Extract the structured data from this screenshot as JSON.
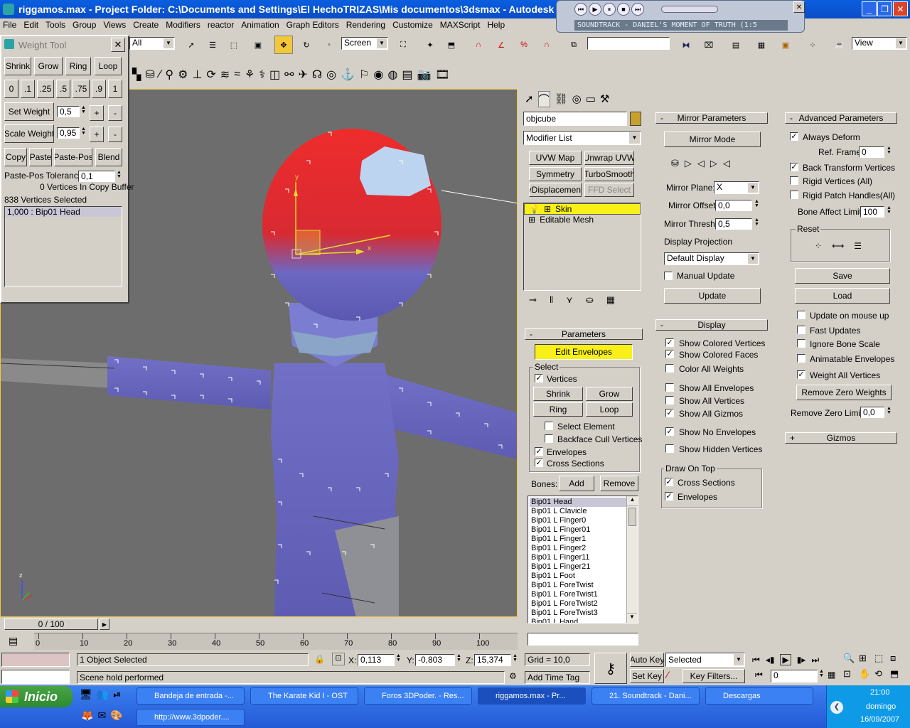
{
  "title_bar": {
    "title": "riggamos.max - Project Folder: C:\\Documents and Settings\\El HechoTRIZAS\\Mis documentos\\3dsmax - Autodesk 3ds"
  },
  "media_player": {
    "track": "SOUNDTRACK - DANIEL'S MOMENT OF TRUTH (1:5"
  },
  "menu": [
    "File",
    "Edit",
    "Tools",
    "Group",
    "Views",
    "Create",
    "Modifiers",
    "reactor",
    "Animation",
    "Graph Editors",
    "Rendering",
    "Customize",
    "MAXScript",
    "Help"
  ],
  "toolbar": {
    "selection_filter": "All",
    "coord_system": "Screen",
    "named_selection": "",
    "view_dropdown": "View"
  },
  "weight_tool": {
    "title": "Weight Tool",
    "row1": [
      "Shrink",
      "Grow",
      "Ring",
      "Loop"
    ],
    "presets": [
      "0",
      ".1",
      ".25",
      ".5",
      ".75",
      ".9",
      "1"
    ],
    "set_weight_label": "Set Weight",
    "set_weight_value": "0,5",
    "scale_weight_label": "Scale Weight",
    "scale_weight_value": "0,95",
    "plus": "+",
    "minus": "-",
    "row4": [
      "Copy",
      "Paste",
      "Paste-Pos",
      "Blend"
    ],
    "tolerance_label": "Paste-Pos Tolerance",
    "tolerance_value": "0,1",
    "copy_buffer": "0 Vertices In Copy Buffer",
    "selected": "838 Vertices Selected",
    "list_item": "1,000 : Bip01 Head"
  },
  "viewport": {
    "axis_y": "y",
    "axis_x": "x",
    "axis_z": "z"
  },
  "modify_panel": {
    "object_name": "objcube",
    "modifier_list": "Modifier List",
    "buttons": [
      "UVW Map",
      "Unwrap UVW",
      "Symmetry",
      "TurboSmooth",
      "yDisplacement",
      "FFD Select"
    ],
    "stack": [
      "Skin",
      "Editable Mesh"
    ]
  },
  "parameters": {
    "header": "Parameters",
    "edit_envelopes": "Edit Envelopes",
    "select_label": "Select",
    "vertices": "Vertices",
    "shrink": "Shrink",
    "grow": "Grow",
    "ring": "Ring",
    "loop": "Loop",
    "select_element": "Select Element",
    "backface": "Backface Cull Vertices",
    "envelopes": "Envelopes",
    "cross_sections": "Cross Sections",
    "bones_label": "Bones:",
    "add": "Add",
    "remove": "Remove",
    "bones": [
      "Bip01 Head",
      "Bip01 L Clavicle",
      "Bip01 L Finger0",
      "Bip01 L Finger01",
      "Bip01 L Finger1",
      "Bip01 L Finger2",
      "Bip01 L Finger11",
      "Bip01 L Finger21",
      "Bip01 L Foot",
      "Bip01 L ForeTwist",
      "Bip01 L ForeTwist1",
      "Bip01 L ForeTwist2",
      "Bip01 L ForeTwist3",
      "Bip01 L Hand"
    ]
  },
  "mirror": {
    "header": "Mirror Parameters",
    "mirror_mode": "Mirror Mode",
    "plane_label": "Mirror Plane:",
    "plane_value": "X",
    "offset_label": "Mirror Offset:",
    "offset_value": "0,0",
    "thresh_label": "Mirror Thresh.:",
    "thresh_value": "0,5",
    "projection_label": "Display Projection",
    "projection_value": "Default Display",
    "manual_update": "Manual Update",
    "update": "Update"
  },
  "display": {
    "header": "Display",
    "items": [
      {
        "label": "Show Colored Vertices",
        "checked": true
      },
      {
        "label": "Show Colored Faces",
        "checked": true
      },
      {
        "label": "Color All Weights",
        "checked": false
      },
      {
        "label": "Show All Envelopes",
        "checked": false
      },
      {
        "label": "Show All Vertices",
        "checked": false
      },
      {
        "label": "Show All Gizmos",
        "checked": true
      },
      {
        "label": "Show No Envelopes",
        "checked": true
      },
      {
        "label": "Show Hidden Vertices",
        "checked": false
      }
    ],
    "draw_on_top": "Draw On Top",
    "draw_cross": "Cross Sections",
    "draw_envelopes": "Envelopes"
  },
  "advanced": {
    "header": "Advanced Parameters",
    "always_deform": "Always Deform",
    "ref_frame_label": "Ref. Frame:",
    "ref_frame_value": "0",
    "back_transform": "Back Transform Vertices",
    "rigid_vertices": "Rigid Vertices (All)",
    "rigid_patch": "Rigid Patch Handles(All)",
    "bone_limit_label": "Bone Affect Limit:",
    "bone_limit_value": "100",
    "reset": "Reset",
    "save": "Save",
    "load": "Load",
    "update_mouse": "Update on mouse up",
    "fast_updates": "Fast Updates",
    "ignore_scale": "Ignore Bone Scale",
    "animatable": "Animatable Envelopes",
    "weight_all": "Weight All Vertices",
    "remove_zero": "Remove Zero Weights",
    "remove_limit_label": "Remove Zero Limit:",
    "remove_limit_value": "0,0",
    "gizmos": "Gizmos"
  },
  "timeline": {
    "slider": "0 / 100",
    "ticks": [
      "0",
      "10",
      "20",
      "30",
      "40",
      "50",
      "60",
      "70",
      "80",
      "90",
      "100"
    ]
  },
  "status": {
    "selected": "1 Object Selected",
    "prompt": "Scene hold performed",
    "x_label": "X:",
    "x": "0,113",
    "y_label": "Y:",
    "y": "-0,803",
    "z_label": "Z:",
    "z": "15,374",
    "grid": "Grid = 10,0",
    "add_time_tag": "Add Time Tag",
    "auto_key": "Auto Key",
    "set_key": "Set Key",
    "key_mode": "Selected",
    "key_filters": "Key Filters...",
    "frame": "0"
  },
  "taskbar": {
    "start": "Inicio",
    "tasks": [
      "Bandeja de entrada -...",
      "The Karate Kid I - OST",
      "Foros 3DPoder. - Res...",
      "riggamos.max - Pr...",
      "21. Soundtrack - Dani...",
      "Descargas",
      "http://www.3dpoder...."
    ],
    "time": "21:00",
    "day": "domingo",
    "date": "16/09/2007"
  }
}
